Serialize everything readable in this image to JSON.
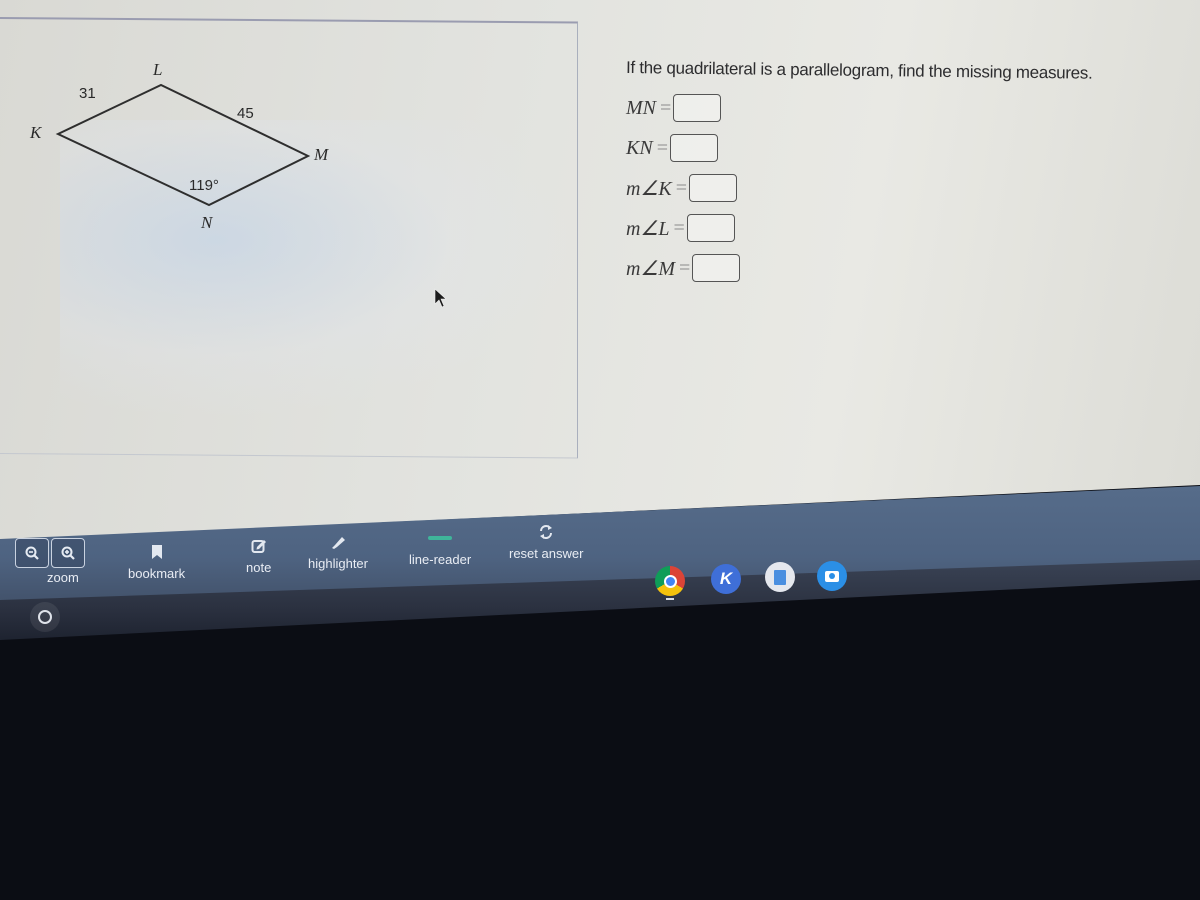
{
  "figure": {
    "vertices": {
      "K": "K",
      "L": "L",
      "M": "M",
      "N": "N"
    },
    "side_KL": "31",
    "side_LM": "45",
    "angle_N": "119°"
  },
  "question": {
    "prompt": "If the quadrilateral is a parallelogram, find the missing measures.",
    "rows": [
      {
        "label": "MN",
        "value": ""
      },
      {
        "label": "KN",
        "value": ""
      },
      {
        "label": "m∠K",
        "value": ""
      },
      {
        "label": "m∠L",
        "value": ""
      },
      {
        "label": "m∠M",
        "value": ""
      }
    ],
    "equals": "="
  },
  "toolbar": {
    "zoom_label": "zoom",
    "bookmark_label": "bookmark",
    "note_label": "note",
    "highlighter_label": "highlighter",
    "line_reader_label": "line-reader",
    "reset_label": "reset answer"
  },
  "shelf": {
    "apps": [
      "chrome",
      "k-app",
      "docs",
      "camera"
    ],
    "k_letter": "K"
  },
  "colors": {
    "toolbar": "#4e6381",
    "line_reader_accent": "#3fb59a",
    "shelf": "#2b3140"
  }
}
